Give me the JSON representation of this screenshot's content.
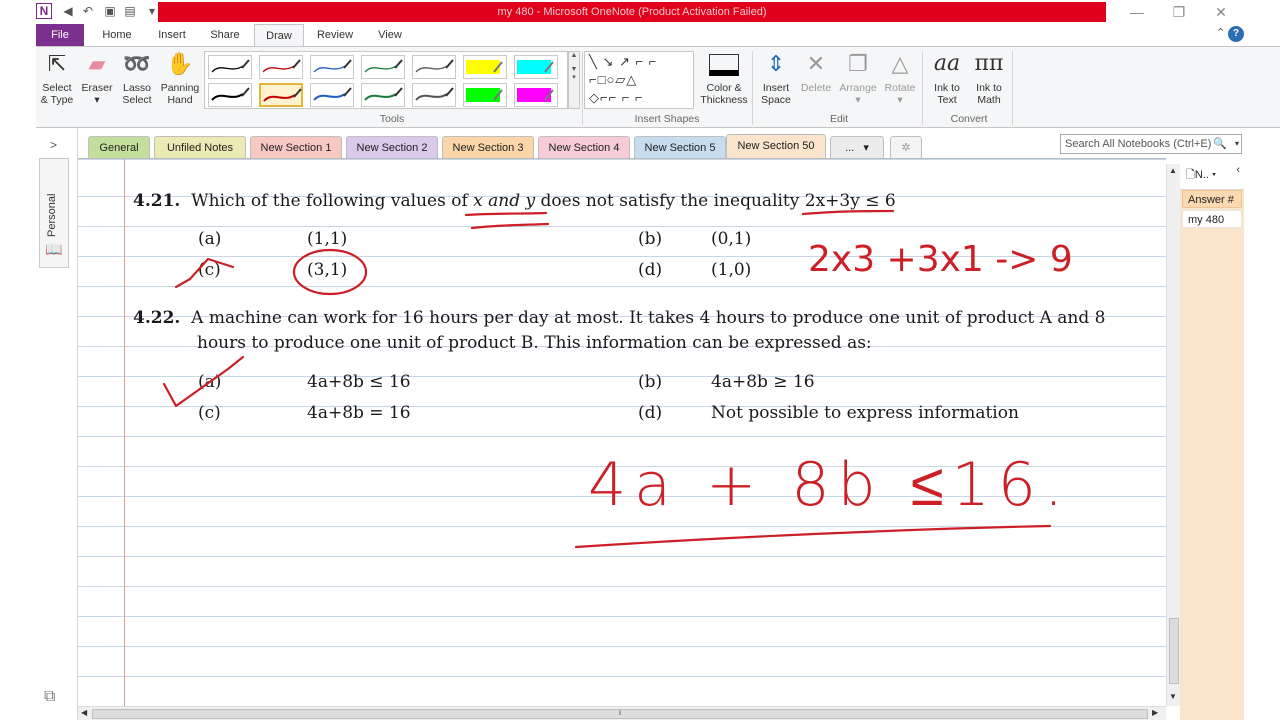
{
  "window": {
    "title": "my 480  -  Microsoft OneNote (Product Activation Failed)",
    "app_icon_letter": "N",
    "controls": [
      "minimize",
      "restore",
      "close"
    ]
  },
  "ribbon": {
    "tabs": [
      "File",
      "Home",
      "Insert",
      "Share",
      "Draw",
      "Review",
      "View"
    ],
    "active_tab": "Draw",
    "tools_group": {
      "label": "Tools",
      "buttons": [
        {
          "label": "Select & Type",
          "line1": "Select",
          "line2": "& Type",
          "icon": "select-cursor-icon"
        },
        {
          "label": "Eraser",
          "line1": "Eraser",
          "line2": "▾",
          "icon": "eraser-icon"
        },
        {
          "label": "Lasso Select",
          "line1": "Lasso",
          "line2": "Select",
          "icon": "lasso-icon"
        },
        {
          "label": "Panning Hand",
          "line1": "Panning",
          "line2": "Hand",
          "icon": "hand-icon"
        }
      ],
      "pen_colors_row1": [
        "#000000",
        "#c00000",
        "#1f5fbf",
        "#1b7a3a",
        "#555555",
        "#ffff00",
        "#00ffff"
      ],
      "pen_colors_row2": [
        "#000000",
        "#c00000",
        "#1f5fbf",
        "#1b7a3a",
        "#555555",
        "#00ff00",
        "#ff00ff"
      ],
      "selected_pen": "red pen, row 2"
    },
    "insert_shapes_group": {
      "label": "Insert Shapes",
      "color_thickness": {
        "line1": "Color &",
        "line2": "Thickness"
      }
    },
    "edit_group": {
      "label": "Edit",
      "buttons": [
        {
          "line1": "Insert",
          "line2": "Space",
          "icon": "insert-space-icon"
        },
        {
          "line1": "Delete",
          "line2": "",
          "icon": "delete-x-icon"
        },
        {
          "line1": "Arrange",
          "line2": "▾",
          "icon": "arrange-icon"
        },
        {
          "line1": "Rotate",
          "line2": "▾",
          "icon": "rotate-icon"
        }
      ]
    },
    "convert_group": {
      "label": "Convert",
      "buttons": [
        {
          "line1": "Ink to",
          "line2": "Text",
          "icon": "ink-to-text-icon",
          "glyph": "aa"
        },
        {
          "line1": "Ink to",
          "line2": "Math",
          "icon": "ink-to-math-icon",
          "glyph": "ππ"
        }
      ]
    }
  },
  "notebook_nav": {
    "expand_glyph": ">",
    "notebook_name": "Personal"
  },
  "sections": {
    "tabs": [
      {
        "label": "General",
        "color": "#c4df9b"
      },
      {
        "label": "Unfiled Notes",
        "color": "#e9eab4"
      },
      {
        "label": "New Section 1",
        "color": "#f8c9c4"
      },
      {
        "label": "New Section 2",
        "color": "#d9c9ea"
      },
      {
        "label": "New Section 3",
        "color": "#fbd6a8"
      },
      {
        "label": "New Section 4",
        "color": "#f7ccd6"
      },
      {
        "label": "New Section 5",
        "color": "#c8dcef"
      },
      {
        "label": "New Section 50",
        "color": "#fbe4cc"
      }
    ],
    "active": "New Section 50",
    "more_label": "...",
    "search_placeholder": "Search All Notebooks (Ctrl+E)"
  },
  "page": {
    "q421": {
      "number": "4.21.",
      "text_a": "Which of the following values of ",
      "text_b": "x and y",
      "text_c": " does not satisfy the inequality ",
      "text_d": "2x+3y ≤ 6",
      "options": [
        {
          "key": "(a)",
          "value": "(1,1)"
        },
        {
          "key": "(b)",
          "value": "(0,1)"
        },
        {
          "key": "(c)",
          "value": "(3,1)"
        },
        {
          "key": "(d)",
          "value": "(1,0)"
        }
      ]
    },
    "q422": {
      "number": "4.22.",
      "line1": "A machine can work for 16 hours per day at most. It takes 4 hours to produce one unit of product A and 8",
      "line2": "hours to produce one unit of product B. This information can be expressed as:",
      "options": [
        {
          "key": "(a)",
          "value": "4a+8b ≤ 16"
        },
        {
          "key": "(b)",
          "value": "4a+8b ≥ 16"
        },
        {
          "key": "(c)",
          "value": "4a+8b = 16"
        },
        {
          "key": "(d)",
          "value": "Not possible to express information"
        }
      ]
    },
    "ink": {
      "color": "#cc1f26",
      "work_421": "2x3 +3x1 -> 9",
      "answer_422": "4a + 8b ≤16."
    }
  },
  "page_pane": {
    "new_page_label": "N..",
    "pages": [
      "Answer #",
      "my 480"
    ],
    "selected": "Answer #"
  }
}
